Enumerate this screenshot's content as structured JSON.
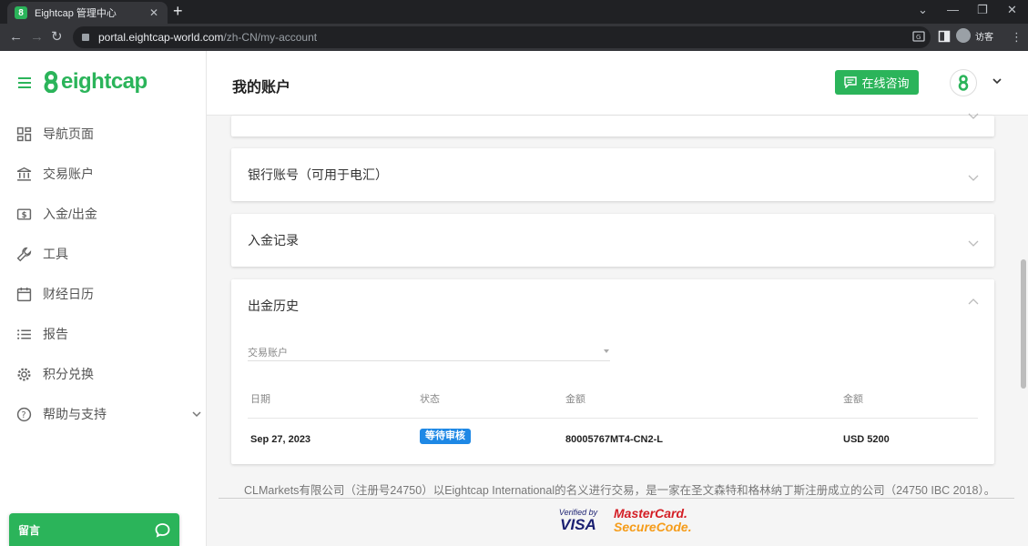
{
  "browser": {
    "tab_title": "Eightcap 管理中心",
    "tab_favicon": "8",
    "url_host": "portal.eightcap-world.com",
    "url_path": "/zh-CN/my-account",
    "profile_label": "访客"
  },
  "sidebar": {
    "logo_text": "eightcap",
    "items": [
      {
        "label": "导航页面",
        "icon": "dashboard-icon"
      },
      {
        "label": "交易账户",
        "icon": "bank-icon"
      },
      {
        "label": "入金/出金",
        "icon": "dollar-icon"
      },
      {
        "label": "工具",
        "icon": "wrench-icon"
      },
      {
        "label": "财经日历",
        "icon": "calendar-icon"
      },
      {
        "label": "报告",
        "icon": "list-icon"
      },
      {
        "label": "积分兑换",
        "icon": "gear-icon"
      },
      {
        "label": "帮助与支持",
        "icon": "help-icon"
      }
    ],
    "message_label": "留言"
  },
  "header": {
    "title": "我的账户",
    "consult_label": "在线咨询",
    "avatar_text": "8"
  },
  "cards": {
    "bank_title": "银行账号（可用于电汇）",
    "deposit_title": "入金记录",
    "withdraw_title": "出金历史"
  },
  "withdraw": {
    "account_label": "交易账户",
    "columns": [
      "日期",
      "状态",
      "金额",
      "金额"
    ],
    "rows": [
      {
        "date": "Sep 27, 2023",
        "status": "等待审核",
        "account": "80005767MT4-CN2-L",
        "amount": "USD 5200"
      }
    ]
  },
  "footer": {
    "text": "CLMarkets有限公司（注册号24750）以Eightcap International的名义进行交易，是一家在圣文森特和格林纳丁斯注册成立的公司（24750 IBC 2018）。",
    "visa_top": "Verified by",
    "visa_bottom": "VISA",
    "mc_top": "MasterCard.",
    "mc_bottom": "SecureCode."
  },
  "colors": {
    "brand": "#2bb45a",
    "status_badge": "#1e88e5"
  }
}
